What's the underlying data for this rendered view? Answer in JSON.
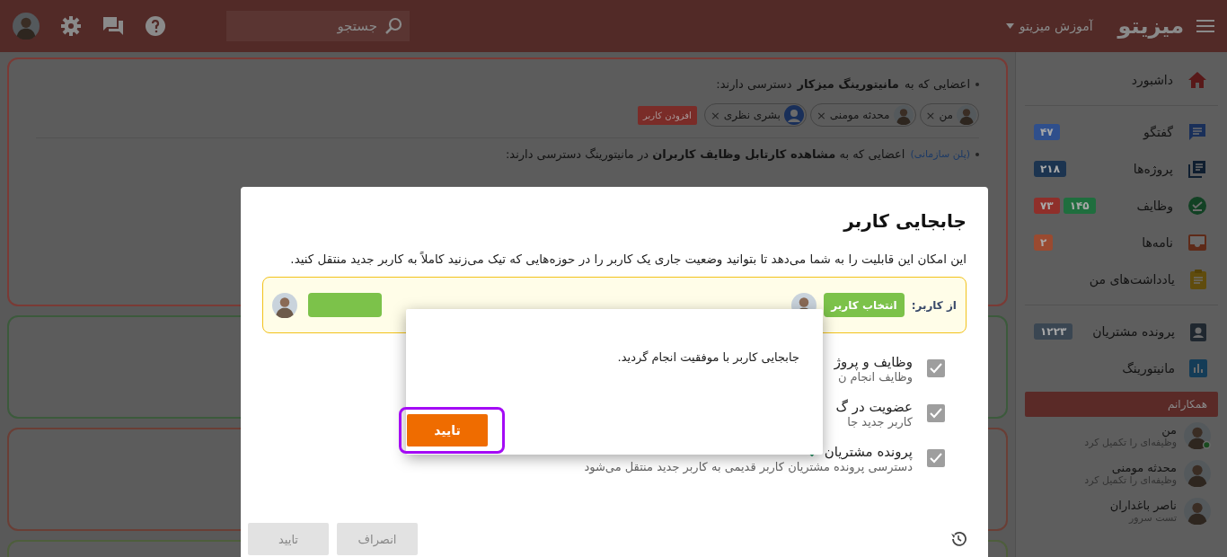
{
  "topbar": {
    "logo": "میزیتو",
    "menu": "آموزش میزیتو",
    "search": {
      "placeholder": "جستجو"
    }
  },
  "sidebar": {
    "groups": [
      [
        {
          "label": "داشبورد"
        }
      ],
      [
        {
          "label": "گفتگو",
          "badges": [
            {
              "text": "۴۷",
              "color": "#2f4f8c"
            }
          ]
        },
        {
          "label": "پروژه‌ها",
          "badges": [
            {
              "text": "۲۱۸",
              "color": "#1c3450"
            }
          ]
        },
        {
          "label": "وظایف",
          "badges": [
            {
              "text": "۱۴۵",
              "color": "#1f6e3e"
            },
            {
              "text": "۷۳",
              "color": "#8f2f2a"
            }
          ]
        },
        {
          "label": "نامه‌ها",
          "badges": [
            {
              "text": "۲",
              "color": "#9a4a30"
            }
          ]
        },
        {
          "label": "یادداشت‌های من"
        }
      ],
      [
        {
          "label": "پرونده مشتریان",
          "badges": [
            {
              "text": "۱۲۲۳",
              "color": "#3a4652"
            }
          ]
        },
        {
          "label": "مانیتورینگ"
        }
      ]
    ],
    "colleagues_title": "همکارانم",
    "colleagues": [
      {
        "name": "من",
        "activity": "وظیفه‌ای را تکمیل کرد",
        "online": true
      },
      {
        "name": "محدثه مومنی",
        "activity": "وظیفه‌ای را تکمیل کرد",
        "online": false
      },
      {
        "name": "ناصر باغداران",
        "activity": "تست سرور",
        "online": false
      }
    ]
  },
  "access_card": {
    "line1": "اعضایی که به **مانیتورینگ میزکار** دسترسی دارند:",
    "chips": [
      {
        "name": "من",
        "kind": "person",
        "remove": "×"
      },
      {
        "name": "محدثه مومنی",
        "kind": "person",
        "remove": "×"
      },
      {
        "name": "بشری نظری",
        "kind": "placeholder",
        "remove": "×"
      }
    ],
    "add_button": "افزودن کاربر",
    "plan_tag": "(پلن سازمانی)",
    "line2": "اعضایی که به **مشاهده کارتابل وظایف کاربران** در مانیتورینگ دسترسی دارند:"
  },
  "cards": [
    {
      "color": "#7a3a35"
    },
    {
      "color": "#3c5a3c"
    },
    {
      "color": "#6a3e35"
    },
    {
      "color": "#4e5e3c"
    }
  ],
  "modal": {
    "title": "جابجایی کاربر",
    "description": "این امکان این قابلیت را به شما می‌دهد تا بتوانید وضعیت جاری یک کاربر را در حوزه‌هایی که تیک می‌زنید کاملاً به کاربر جدید منتقل کنید.",
    "from_label": "از کاربر:",
    "select_button": "انتخاب کاربر",
    "options": [
      {
        "title": "وظایف و پروژ",
        "description": "وظایف انجام ن",
        "checked": true,
        "verified": false
      },
      {
        "title": "عضویت در گ",
        "description": "کاربر جدید جا",
        "checked": true,
        "verified": false
      },
      {
        "title": "پرونده مشتریان",
        "description": "دسترسی پرونده مشتریان کاربر قدیمی به کاربر جدید منتقل می‌شود",
        "checked": true,
        "verified": true
      }
    ],
    "buttons": [
      {
        "label": "انصراف"
      },
      {
        "label": "تایید"
      }
    ]
  },
  "dialog": {
    "message": "جابجایی کاربر با موفقیت انجام گردید.",
    "button": "تایید"
  }
}
